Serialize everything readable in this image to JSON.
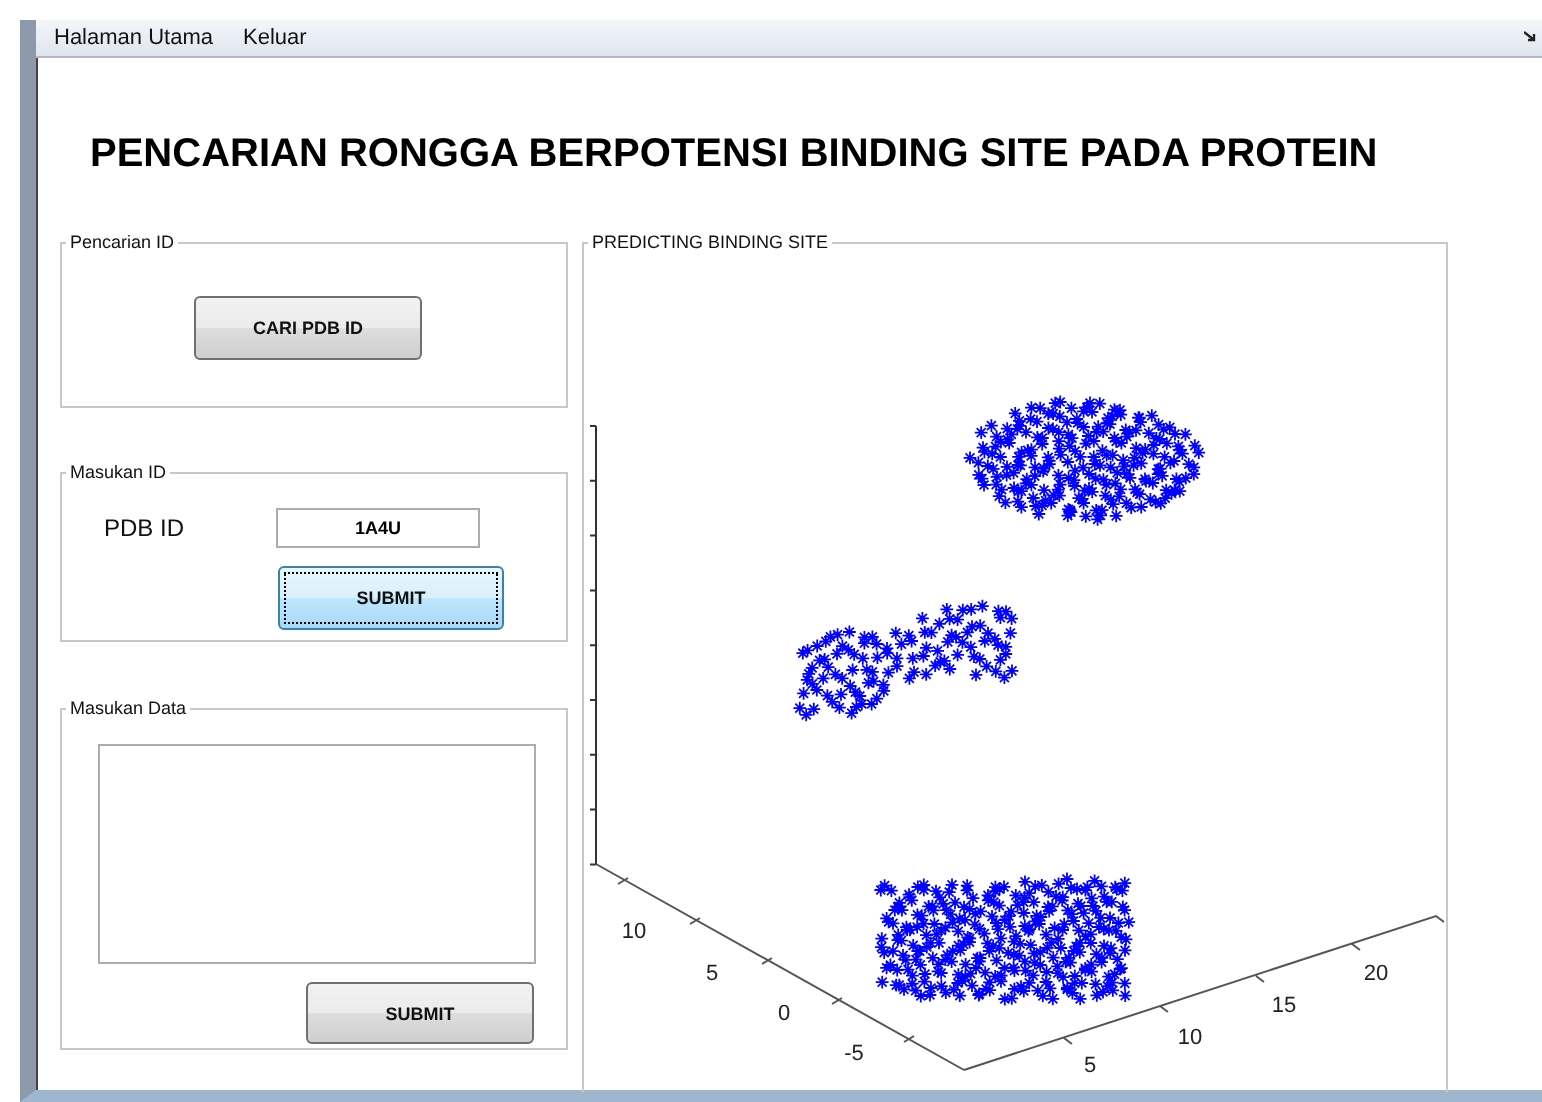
{
  "menu": [
    {
      "label": "Halaman Utama"
    },
    {
      "label": "Keluar"
    }
  ],
  "title": "PENCARIAN RONGGA BERPOTENSI BINDING SITE PADA PROTEIN",
  "panels": [
    {
      "kind": "search",
      "title": "Pencarian ID",
      "button": {
        "label": "CARI PDB ID",
        "focused": false
      }
    },
    {
      "kind": "id_input",
      "title": "Masukan ID",
      "label": "PDB ID",
      "value": "1A4U",
      "button": {
        "label": "SUBMIT",
        "focused": true
      }
    },
    {
      "kind": "data_input",
      "title": "Masukan Data",
      "button": {
        "label": "SUBMIT",
        "focused": false
      }
    }
  ],
  "plot": {
    "title": "PREDICTING BINDING SITE",
    "y_ticks": [
      "10",
      "5",
      "0",
      "-5"
    ],
    "x_ticks": [
      "5",
      "10",
      "15",
      "20"
    ]
  }
}
